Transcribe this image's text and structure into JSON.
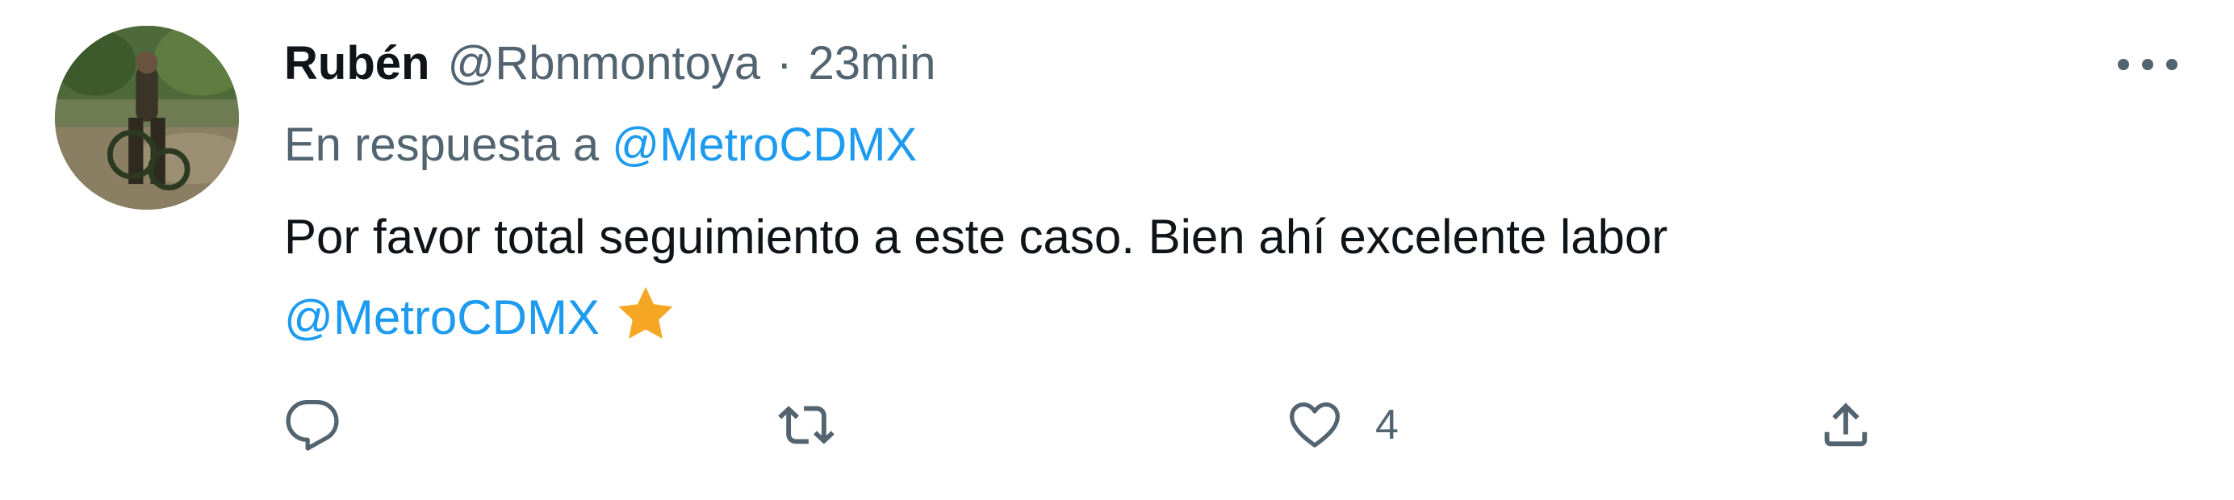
{
  "tweet": {
    "author": {
      "display_name": "Rubén",
      "handle": "@Rbnmontoya",
      "separator": "·",
      "time": "23min"
    },
    "reply_to": {
      "prefix": "En respuesta a",
      "mention": "@MetroCDMX"
    },
    "text": {
      "line1": "Por favor total seguimiento a este caso. Bien ahí excelente labor",
      "mention": "@MetroCDMX",
      "emoji": "star"
    },
    "actions": {
      "reply": {
        "icon": "reply-icon",
        "count": ""
      },
      "retweet": {
        "icon": "retweet-icon",
        "count": ""
      },
      "like": {
        "icon": "heart-icon",
        "count": "4"
      },
      "share": {
        "icon": "share-icon",
        "count": ""
      }
    },
    "more_icon": "more-icon"
  },
  "colors": {
    "text_primary": "#0f1419",
    "text_secondary": "#536471",
    "mention": "#1d9bf0",
    "star": "#f5a623"
  }
}
